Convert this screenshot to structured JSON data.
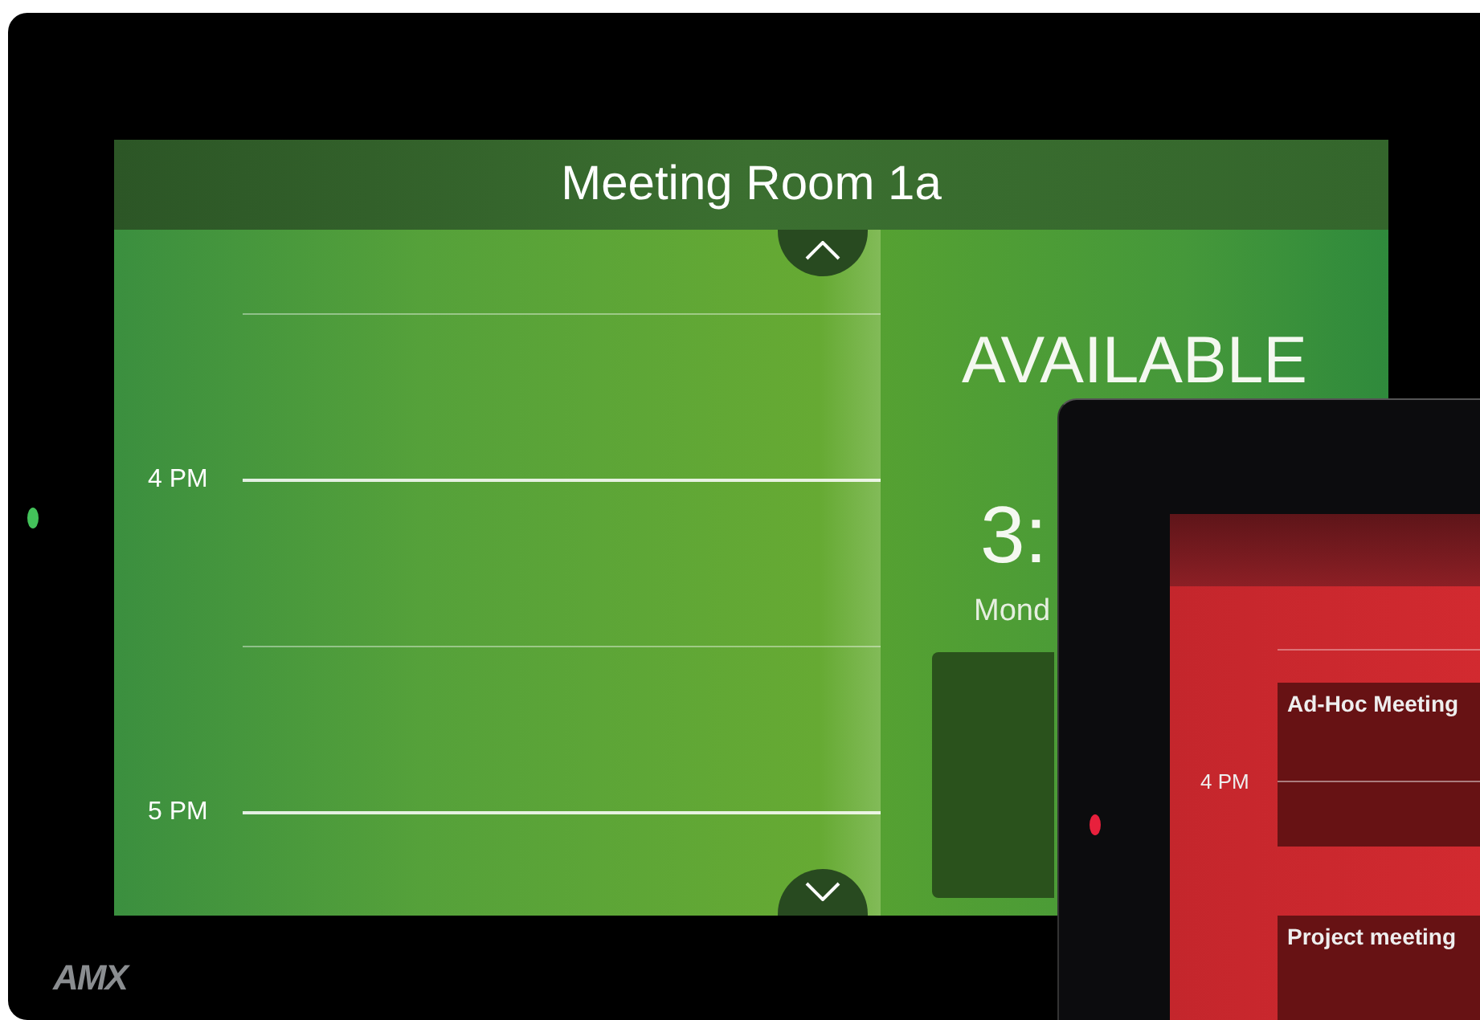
{
  "panels": [
    {
      "kind": "available",
      "title": "Meeting Room 1a",
      "time_slots": [
        {
          "label": "4 PM"
        },
        {
          "label": "5 PM"
        }
      ],
      "status": "AVAILABLE",
      "clock": "3:",
      "date": "Mond",
      "brand": "AMX"
    },
    {
      "kind": "occupied",
      "time_slots": [
        {
          "label": "4 PM"
        }
      ],
      "events": [
        {
          "title": "Ad-Hoc Meeting"
        },
        {
          "title": "Project meeting"
        }
      ]
    }
  ]
}
